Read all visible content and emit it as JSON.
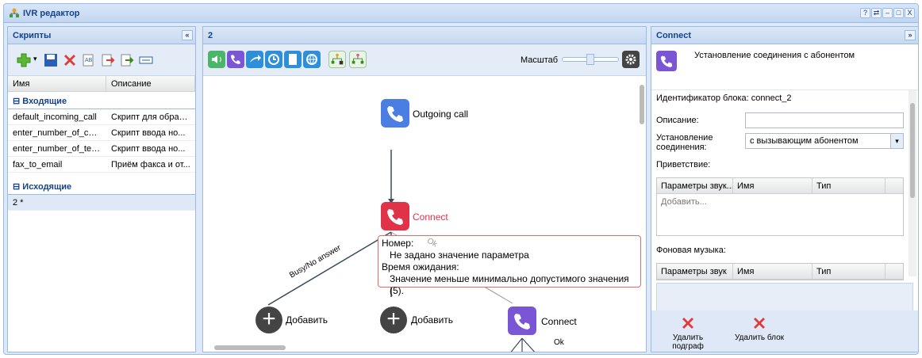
{
  "window": {
    "title": "IVR редактор",
    "title_buttons": [
      "?",
      "⇄",
      "–",
      "□",
      "X"
    ]
  },
  "left": {
    "title": "Скрипты",
    "collapse": "«",
    "columns": [
      "Имя",
      "Описание"
    ],
    "groups": [
      {
        "label": "Входящие",
        "rows": [
          [
            "default_incoming_call",
            "Скрипт для обраб..."
          ],
          [
            "enter_number_of_confe...",
            "Скрипт ввода но..."
          ],
          [
            "enter_number_of_telec...",
            "Скрипт ввода но..."
          ],
          [
            "fax_to_email",
            "Приём факса и от..."
          ]
        ]
      },
      {
        "label": "Исходящие",
        "rows": [
          [
            "2 *",
            ""
          ]
        ]
      }
    ]
  },
  "center": {
    "title": "2",
    "scale_label": "Масштаб",
    "nodes": {
      "outgoing": "Outgoing call",
      "connect1": "Connect",
      "connect2": "Connect",
      "add1": "Добавить",
      "add2": "Добавить"
    },
    "edges": {
      "busy": "Busy/No answer",
      "ok1": "Ok",
      "ok2": "Ok"
    },
    "error": {
      "line1": "Номер:",
      "line2": "Не задано значение параметра",
      "line3": "Время ожидания:",
      "line4": "Значение меньше минимально допустимого значения (5)."
    }
  },
  "right": {
    "title": "Connect",
    "collapse": "»",
    "header_text": "Установление соединения с абонентом",
    "block_id": "Идентификатор блока: connect_2",
    "desc_label": "Описание:",
    "conn_label": "Установление соединения:",
    "conn_value": "с вызывающим абонентом",
    "greeting_label": "Приветствие:",
    "grid_cols": [
      "Параметры звук...",
      "Имя",
      "Тип"
    ],
    "grid_add": "Добавить...",
    "bg_music_label": "Фоновая музыка:",
    "grid2_cols": [
      "Параметры звук",
      "Имя",
      "Тип"
    ],
    "delete_subgraph": "Удалить подграф",
    "delete_block": "Удалить блок"
  },
  "colors": {
    "blue_node": "#4a7ee3",
    "red_node": "#e0334a",
    "purple_node": "#7a55d6",
    "header_text": "#15428b"
  }
}
